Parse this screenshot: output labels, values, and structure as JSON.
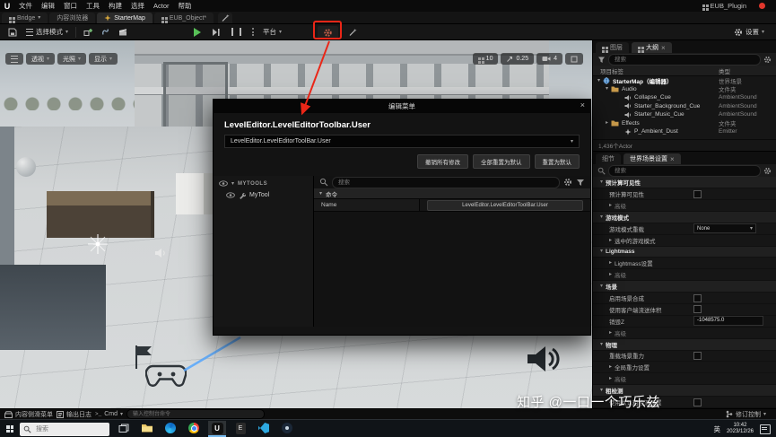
{
  "colors": {
    "annotation_red": "#ea2617",
    "record_red": "#e0362c",
    "accent_blue": "#0f6fd7",
    "play_green": "#58c158",
    "folder_yellow": "#c89a4a"
  },
  "icons": {
    "search-icon": "magnifier",
    "gear-icon": "gear",
    "filter-icon": "funnel",
    "save-icon": "floppy",
    "hamburger-icon": "three-lines",
    "add-icon": "cube-plus",
    "blueprint-icon": "ribbon",
    "cinematics-icon": "clapperboard",
    "play-icon": "green-triangle",
    "skip-icon": "triangle-bar",
    "pause-icon": "double-bar",
    "eye-icon": "eye",
    "wrench-icon": "wrench",
    "folder-icon": "folder",
    "globe-icon": "globe",
    "speaker-icon": "speaker",
    "emitter-icon": "sparkle",
    "close-icon": "cross",
    "caret-down-icon": "triangle-down",
    "caret-right-icon": "triangle-right",
    "wand-icon": "wand-star",
    "flag-icon": "flag",
    "gamepad-icon": "gamepad",
    "windows-start-icon": "four-squares",
    "camera-icon": "camera",
    "maximize-icon": "square-outline",
    "revision-icon": "branch"
  },
  "menubar": {
    "items": [
      "文件",
      "编辑",
      "窗口",
      "工具",
      "构建",
      "选择",
      "Actor",
      "帮助"
    ],
    "plugin_label": "EUB_Plugin"
  },
  "doc_tabs": {
    "bridge": "Bridge",
    "content_browser": "内容浏览器",
    "starter_map": "StarterMap",
    "eub_object": "EUB_Object*"
  },
  "toolbar": {
    "select_mode": "选择模式",
    "platforms": "平台",
    "settings": "设置"
  },
  "viewport": {
    "perspective": "透视",
    "lit": "光照",
    "show": "显示",
    "grid_snap": "10",
    "scale_snap": "0.25",
    "camera_speed": "4"
  },
  "dialog": {
    "title": "编辑菜单",
    "heading": "LevelEditor.LevelEditorToolbar.User",
    "combo_value": "LevelEditor.LevelEditorToolBar.User",
    "revert_all": "撤销所有修改",
    "reset_all": "全部重置为默认",
    "reset_default": "重置为默认",
    "group_label": "MYTOOLS",
    "tool_label": "MyTool",
    "search_placeholder": "搜索",
    "section_label": "命令",
    "name_label": "Name",
    "entry_value": "LevelEditor.LevelEditorToolBar.User"
  },
  "outliner": {
    "tab_layers": "图层",
    "tab_outliner": "大纲",
    "search_placeholder": "搜索",
    "col_item": "项目标签",
    "col_type": "类型",
    "rows": [
      {
        "label": "StarterMap（编辑器）",
        "type": "世界场景",
        "depth": 0,
        "icon": "globe-icon"
      },
      {
        "label": "Audio",
        "type": "文件夹",
        "depth": 1,
        "icon": "folder-icon"
      },
      {
        "label": "Collapse_Cue",
        "type": "AmbientSound",
        "depth": 2,
        "icon": "speaker-icon"
      },
      {
        "label": "Starter_Background_Cue",
        "type": "AmbientSound",
        "depth": 2,
        "icon": "speaker-icon"
      },
      {
        "label": "Starter_Music_Cue",
        "type": "AmbientSound",
        "depth": 2,
        "icon": "speaker-icon"
      },
      {
        "label": "Effects",
        "type": "文件夹",
        "depth": 1,
        "icon": "folder-icon"
      },
      {
        "label": "P_Ambient_Dust",
        "type": "Emitter",
        "depth": 2,
        "icon": "emitter-icon"
      }
    ],
    "footer": "1,436个Actor"
  },
  "details": {
    "tab_details": "细节",
    "tab_world_settings": "世界场景设置",
    "search_placeholder": "搜索",
    "rows": [
      {
        "kind": "section",
        "label": "预计算可见性"
      },
      {
        "kind": "check",
        "label": "预计算可见性"
      },
      {
        "kind": "advanced",
        "label": "高级"
      },
      {
        "kind": "section",
        "label": "游戏模式"
      },
      {
        "kind": "dropdown",
        "label": "游戏模式重载",
        "value": "None"
      },
      {
        "kind": "expand",
        "label": "选中的游戏模式"
      },
      {
        "kind": "section",
        "label": "Lightmass"
      },
      {
        "kind": "expand",
        "label": "Lightmass设置"
      },
      {
        "kind": "advanced",
        "label": "高级"
      },
      {
        "kind": "section",
        "label": "场景"
      },
      {
        "kind": "check",
        "label": "启用场景合成"
      },
      {
        "kind": "check",
        "label": "使用客户端流送体积"
      },
      {
        "kind": "value",
        "label": "销毁Z",
        "value": "-1048575.0"
      },
      {
        "kind": "advanced",
        "label": "高级"
      },
      {
        "kind": "section",
        "label": "物理"
      },
      {
        "kind": "check",
        "label": "重载场景重力"
      },
      {
        "kind": "expand",
        "label": "全局重力设置"
      },
      {
        "kind": "advanced",
        "label": "高级"
      },
      {
        "kind": "section",
        "label": "粗检测"
      },
      {
        "kind": "check",
        "label": "使用默认粗检测设置"
      }
    ]
  },
  "statusbar": {
    "content_drawer": "内容侧滑菜单",
    "output_log": "输出日志",
    "cmd": "Cmd",
    "console_placeholder": "输入控制台命令",
    "revision_control": "修订控制"
  },
  "taskbar": {
    "search_placeholder": "搜索",
    "language": "英",
    "time": "10:42",
    "date": "2023/12/26"
  },
  "watermark": {
    "text": "知乎 @一口一个巧乐兹"
  }
}
